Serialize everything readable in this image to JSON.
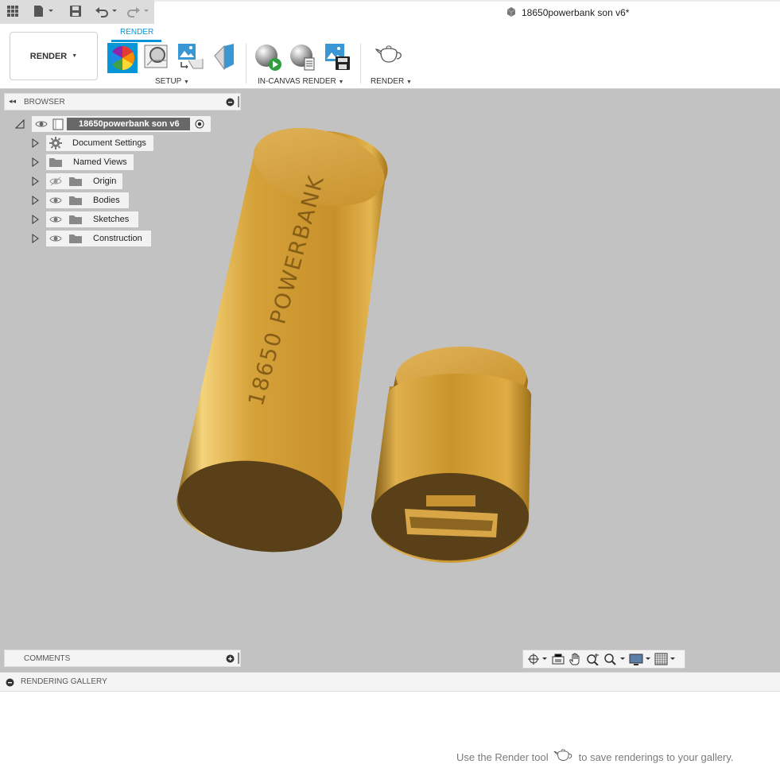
{
  "document": {
    "title": "18650powerbank son v6*"
  },
  "ribbon": {
    "active_tab": "RENDER",
    "workspace_label": "RENDER",
    "groups": [
      {
        "label": "SETUP"
      },
      {
        "label": "IN-CANVAS RENDER"
      },
      {
        "label": "RENDER"
      }
    ]
  },
  "browser": {
    "header": "BROWSER",
    "root": {
      "label": "18650powerbank son v6"
    },
    "items": [
      {
        "label": "Document Settings",
        "icon": "gear-icon"
      },
      {
        "label": "Named Views",
        "icon": "folder-icon"
      },
      {
        "label": "Origin",
        "icon": "folder-icon",
        "visibility": "hidden"
      },
      {
        "label": "Bodies",
        "icon": "folder-icon",
        "visibility": "visible"
      },
      {
        "label": "Sketches",
        "icon": "folder-icon",
        "visibility": "visible"
      },
      {
        "label": "Construction",
        "icon": "folder-icon",
        "visibility": "visible"
      }
    ]
  },
  "model": {
    "engraving": "18650 POWERBANK"
  },
  "comments": {
    "header": "COMMENTS"
  },
  "gallery": {
    "header": "RENDERING GALLERY",
    "hint_before": "Use the Render tool",
    "hint_after": "to save renderings to your gallery."
  },
  "colors": {
    "accent": "#0696d7",
    "model": "#c9952a",
    "canvas": "#c2c2c2"
  }
}
